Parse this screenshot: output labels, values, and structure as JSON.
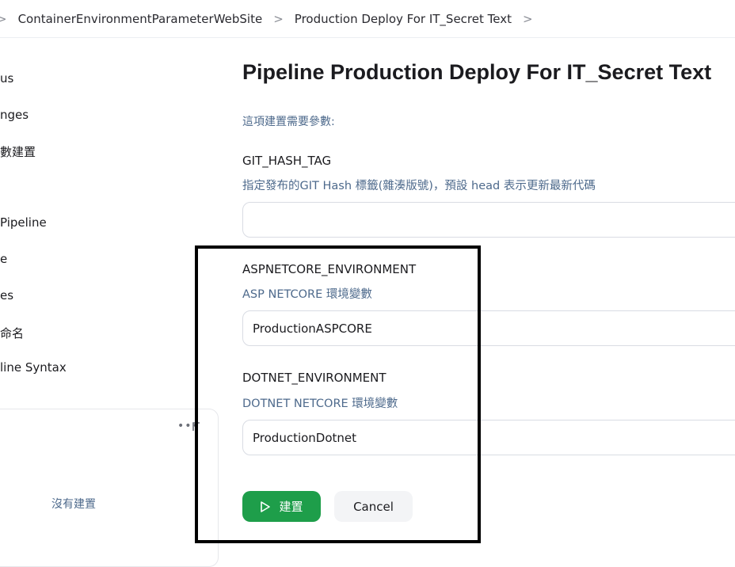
{
  "breadcrumb": {
    "items": [
      "ContainerEnvironmentParameterWebSite",
      "Production Deploy For IT_Secret Text"
    ]
  },
  "sidebar": {
    "items": [
      "us",
      "nges",
      "數建置",
      "Pipeline",
      "e",
      "es",
      "命名",
      "line Syntax"
    ],
    "panel": {
      "more": "•••",
      "empty_text": "沒有建置"
    }
  },
  "main": {
    "title": "Pipeline Production Deploy For IT_Secret Text",
    "intro": "這項建置需要參數:",
    "params": [
      {
        "name": "GIT_HASH_TAG",
        "description": "指定發布的GIT Hash 標籤(雜湊版號)，預設 head 表示更新最新代碼",
        "value": ""
      },
      {
        "name": "ASPNETCORE_ENVIRONMENT",
        "description": "ASP NETCORE 環境變數",
        "value": "ProductionASPCORE"
      },
      {
        "name": "DOTNET_ENVIRONMENT",
        "description": "DOTNET NETCORE 環境變數",
        "value": "ProductionDotnet"
      }
    ],
    "build_label": "建置",
    "cancel_label": "Cancel"
  },
  "colors": {
    "accent_green": "#1e9e4a",
    "description_blue": "#4e6a8c",
    "highlight_border": "#000000"
  },
  "icons": [
    "chevron-right-icon",
    "play-icon",
    "more-icon"
  ]
}
